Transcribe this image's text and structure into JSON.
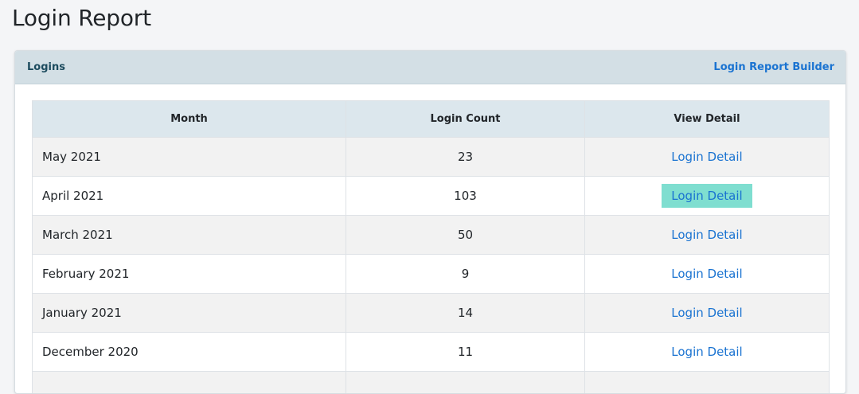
{
  "page": {
    "title": "Login Report"
  },
  "card": {
    "title": "Logins",
    "builder_link": "Login Report Builder"
  },
  "table": {
    "headers": [
      "Month",
      "Login Count",
      "View Detail"
    ],
    "rows": [
      {
        "month": "May 2021",
        "count": "23",
        "link": "Login Detail"
      },
      {
        "month": "April 2021",
        "count": "103",
        "link": "Login Detail",
        "highlighted": true
      },
      {
        "month": "March 2021",
        "count": "50",
        "link": "Login Detail"
      },
      {
        "month": "February 2021",
        "count": "9",
        "link": "Login Detail"
      },
      {
        "month": "January 2021",
        "count": "14",
        "link": "Login Detail"
      },
      {
        "month": "December 2020",
        "count": "11",
        "link": "Login Detail"
      },
      {
        "month": "",
        "count": "",
        "link": ""
      }
    ]
  },
  "colors": {
    "link": "#1a73d1",
    "highlight": "#7fded0",
    "header_bg": "#d3dfe5"
  }
}
